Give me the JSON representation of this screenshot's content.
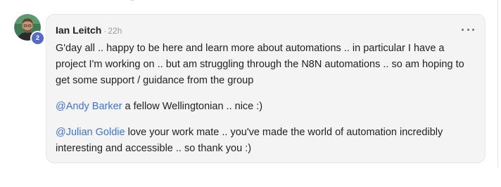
{
  "comment": {
    "author": "Ian Leitch",
    "separator": "·",
    "time_ago": "22h",
    "level_badge": "2",
    "more_menu_icon": "more-horizontal-icon",
    "paragraphs": [
      {
        "text": "G'day all .. happy to be here and learn more about automations .. in particular I have a project I'm working on .. but am struggling through the N8N automations .. so am hoping to get some support / guidance from the group"
      },
      {
        "mention": "@Andy Barker",
        "text": " a fellow Wellingtonian .. nice :)"
      },
      {
        "mention": "@Julian Goldie",
        "text": " love your work mate .. you've made the world of automation incredibly interesting and accessible .. so thank you :)"
      }
    ]
  },
  "colors": {
    "bubble_background": "#f4f4f4",
    "mention_link": "#3d73d8",
    "badge": "#5569c9",
    "timestamp": "#9a9a9a"
  }
}
